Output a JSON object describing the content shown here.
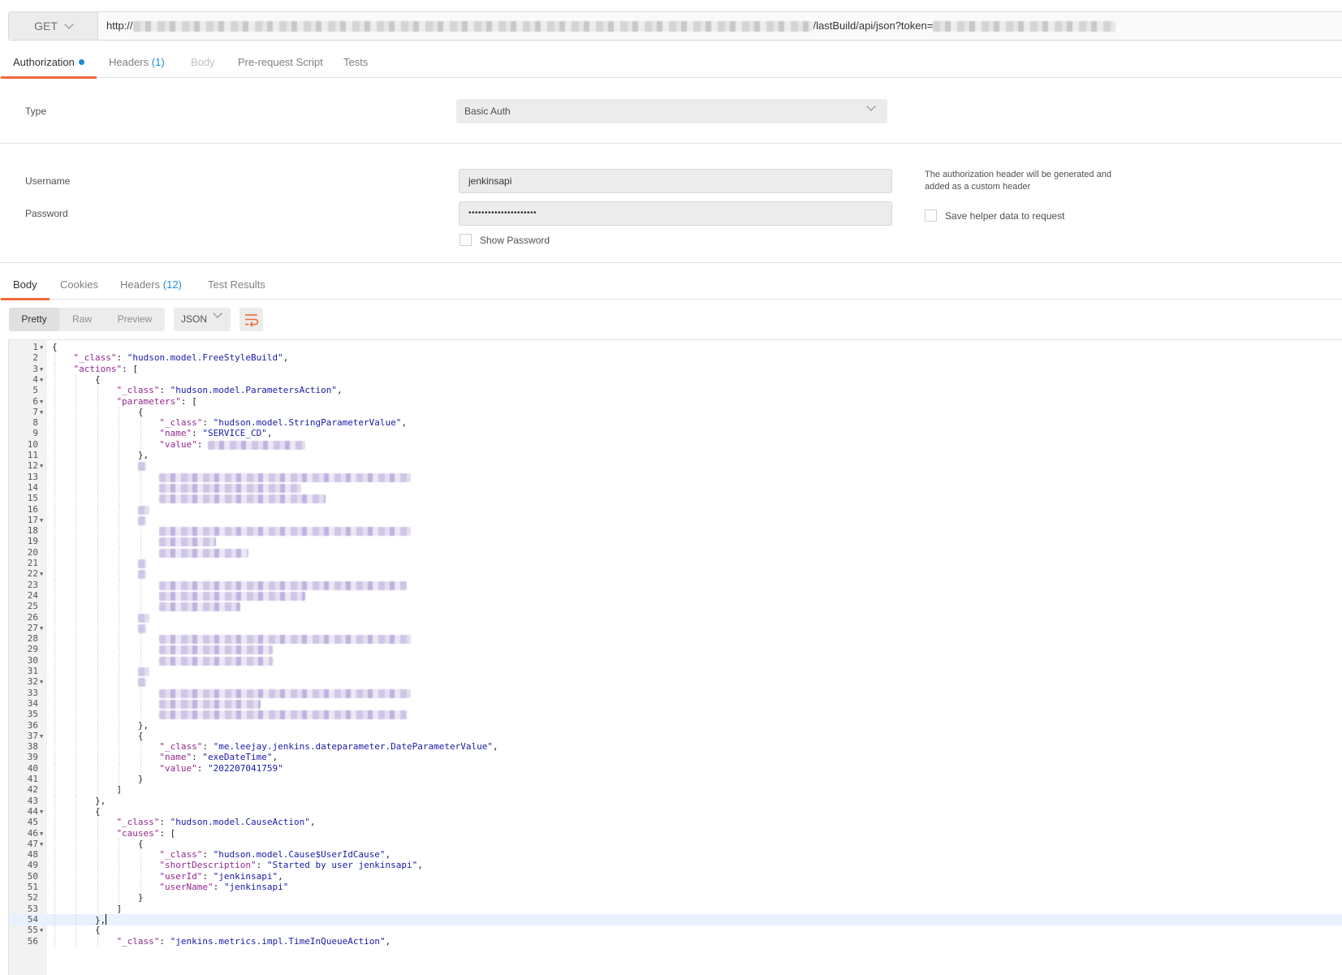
{
  "request": {
    "method": "GET",
    "url_prefix": "http://",
    "url_middle": "/lastBuild/api/json?token="
  },
  "request_tabs": [
    {
      "label": "Authorization",
      "count": ""
    },
    {
      "label": "Headers",
      "count": "(1)"
    },
    {
      "label": "Body",
      "count": ""
    },
    {
      "label": "Pre-request Script",
      "count": ""
    },
    {
      "label": "Tests",
      "count": ""
    }
  ],
  "auth": {
    "type_label": "Type",
    "type_value": "Basic Auth",
    "username_label": "Username",
    "username_value": "jenkinsapi",
    "password_label": "Password",
    "password_value": "•••••••••••••••••••••",
    "show_password_label": "Show Password",
    "note": "The authorization header will be generated and added as a custom header",
    "save_helper_label": "Save helper data to request"
  },
  "response_tabs": [
    {
      "label": "Body",
      "count": ""
    },
    {
      "label": "Cookies",
      "count": ""
    },
    {
      "label": "Headers",
      "count": "(12)"
    },
    {
      "label": "Test Results",
      "count": ""
    }
  ],
  "view_modes": [
    "Pretty",
    "Raw",
    "Preview"
  ],
  "format": "JSON",
  "icons": {
    "method_dropdown": "chevron-down-icon",
    "wrap": "wrap-lines-icon",
    "fold": "fold-arrow-icon"
  },
  "colors": {
    "accent": "#f26b3a",
    "link": "#1e8bd2",
    "json_key": "#92288f",
    "json_string": "#1a1aa6"
  },
  "code_lines": [
    {
      "n": "1",
      "fold": true,
      "indent": 0,
      "text": "{"
    },
    {
      "n": "2",
      "fold": false,
      "indent": 1,
      "key": "_class",
      "val": "\"hudson.model.FreeStyleBuild\"",
      "tail": ","
    },
    {
      "n": "3",
      "fold": true,
      "indent": 1,
      "key": "actions",
      "tail": ": ["
    },
    {
      "n": "4",
      "fold": true,
      "indent": 2,
      "text": "{"
    },
    {
      "n": "5",
      "fold": false,
      "indent": 3,
      "key": "_class",
      "val": "\"hudson.model.ParametersAction\"",
      "tail": ","
    },
    {
      "n": "6",
      "fold": true,
      "indent": 3,
      "key": "parameters",
      "tail": ": ["
    },
    {
      "n": "7",
      "fold": true,
      "indent": 4,
      "text": "{"
    },
    {
      "n": "8",
      "fold": false,
      "indent": 5,
      "key": "_class",
      "val": "\"hudson.model.StringParameterValue\"",
      "tail": ","
    },
    {
      "n": "9",
      "fold": false,
      "indent": 5,
      "key": "name",
      "val": "\"SERVICE_CD\"",
      "tail": ","
    },
    {
      "n": "10",
      "fold": false,
      "indent": 5,
      "key": "value",
      "tail": ":",
      "redact": 120
    },
    {
      "n": "11",
      "fold": false,
      "indent": 4,
      "text": "},"
    },
    {
      "n": "12",
      "fold": true,
      "indent": 4,
      "redact": 10
    },
    {
      "n": "13",
      "fold": false,
      "indent": 5,
      "redact": 310
    },
    {
      "n": "14",
      "fold": false,
      "indent": 5,
      "redact": 175
    },
    {
      "n": "15",
      "fold": false,
      "indent": 5,
      "redact": 205
    },
    {
      "n": "16",
      "fold": false,
      "indent": 4,
      "redact": 14
    },
    {
      "n": "17",
      "fold": true,
      "indent": 4,
      "redact": 10
    },
    {
      "n": "18",
      "fold": false,
      "indent": 5,
      "redact": 310
    },
    {
      "n": "19",
      "fold": false,
      "indent": 5,
      "redact": 70
    },
    {
      "n": "20",
      "fold": false,
      "indent": 5,
      "redact": 110
    },
    {
      "n": "21",
      "fold": false,
      "indent": 4,
      "redact": 10
    },
    {
      "n": "22",
      "fold": true,
      "indent": 4,
      "redact": 10
    },
    {
      "n": "23",
      "fold": false,
      "indent": 5,
      "redact": 305
    },
    {
      "n": "24",
      "fold": false,
      "indent": 5,
      "redact": 180
    },
    {
      "n": "25",
      "fold": false,
      "indent": 5,
      "redact": 100
    },
    {
      "n": "26",
      "fold": false,
      "indent": 4,
      "redact": 14
    },
    {
      "n": "27",
      "fold": true,
      "indent": 4,
      "redact": 10
    },
    {
      "n": "28",
      "fold": false,
      "indent": 5,
      "redact": 310
    },
    {
      "n": "29",
      "fold": false,
      "indent": 5,
      "redact": 140
    },
    {
      "n": "30",
      "fold": false,
      "indent": 5,
      "redact": 140
    },
    {
      "n": "31",
      "fold": false,
      "indent": 4,
      "redact": 14
    },
    {
      "n": "32",
      "fold": true,
      "indent": 4,
      "redact": 10
    },
    {
      "n": "33",
      "fold": false,
      "indent": 5,
      "redact": 310
    },
    {
      "n": "34",
      "fold": false,
      "indent": 5,
      "redact": 125
    },
    {
      "n": "35",
      "fold": false,
      "indent": 5,
      "redact": 305
    },
    {
      "n": "36",
      "fold": false,
      "indent": 4,
      "text": "},"
    },
    {
      "n": "37",
      "fold": true,
      "indent": 4,
      "text": "{"
    },
    {
      "n": "38",
      "fold": false,
      "indent": 5,
      "key": "_class",
      "val": "\"me.leejay.jenkins.dateparameter.DateParameterValue\"",
      "tail": ","
    },
    {
      "n": "39",
      "fold": false,
      "indent": 5,
      "key": "name",
      "val": "\"exeDateTime\"",
      "tail": ","
    },
    {
      "n": "40",
      "fold": false,
      "indent": 5,
      "key": "value",
      "val": "\"202207041759\"",
      "tail": ""
    },
    {
      "n": "41",
      "fold": false,
      "indent": 4,
      "text": "}"
    },
    {
      "n": "42",
      "fold": false,
      "indent": 3,
      "text": "]"
    },
    {
      "n": "43",
      "fold": false,
      "indent": 2,
      "text": "},"
    },
    {
      "n": "44",
      "fold": true,
      "indent": 2,
      "text": "{"
    },
    {
      "n": "45",
      "fold": false,
      "indent": 3,
      "key": "_class",
      "val": "\"hudson.model.CauseAction\"",
      "tail": ","
    },
    {
      "n": "46",
      "fold": true,
      "indent": 3,
      "key": "causes",
      "tail": ": ["
    },
    {
      "n": "47",
      "fold": true,
      "indent": 4,
      "text": "{"
    },
    {
      "n": "48",
      "fold": false,
      "indent": 5,
      "key": "_class",
      "val": "\"hudson.model.Cause$UserIdCause\"",
      "tail": ","
    },
    {
      "n": "49",
      "fold": false,
      "indent": 5,
      "key": "shortDescription",
      "val": "\"Started by user jenkinsapi\"",
      "tail": ","
    },
    {
      "n": "50",
      "fold": false,
      "indent": 5,
      "key": "userId",
      "val": "\"jenkinsapi\"",
      "tail": ","
    },
    {
      "n": "51",
      "fold": false,
      "indent": 5,
      "key": "userName",
      "val": "\"jenkinsapi\"",
      "tail": ""
    },
    {
      "n": "52",
      "fold": false,
      "indent": 4,
      "text": "}"
    },
    {
      "n": "53",
      "fold": false,
      "indent": 3,
      "text": "]"
    },
    {
      "n": "54",
      "fold": false,
      "indent": 2,
      "text": "},",
      "current": true
    },
    {
      "n": "55",
      "fold": true,
      "indent": 2,
      "text": "{"
    },
    {
      "n": "56",
      "fold": false,
      "indent": 3,
      "key": "_class",
      "val": "\"jenkins.metrics.impl.TimeInQueueAction\"",
      "tail": ","
    }
  ]
}
